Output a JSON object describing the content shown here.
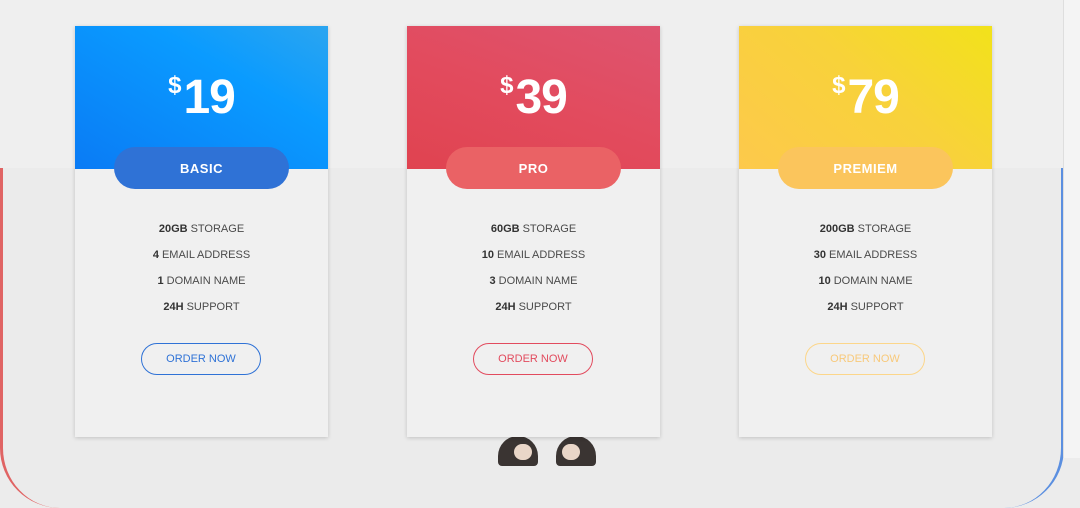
{
  "plans": [
    {
      "currency": "$",
      "price": "19",
      "name": "BASIC",
      "features": [
        {
          "value": "20GB",
          "label": "STORAGE"
        },
        {
          "value": "4",
          "label": "EMAIL ADDRESS"
        },
        {
          "value": "1",
          "label": "DOMAIN NAME"
        },
        {
          "value": "24H",
          "label": "SUPPORT"
        }
      ],
      "cta": "ORDER NOW"
    },
    {
      "currency": "$",
      "price": "39",
      "name": "PRO",
      "features": [
        {
          "value": "60GB",
          "label": "STORAGE"
        },
        {
          "value": "10",
          "label": "EMAIL ADDRESS"
        },
        {
          "value": "3",
          "label": "DOMAIN NAME"
        },
        {
          "value": "24H",
          "label": "SUPPORT"
        }
      ],
      "cta": "ORDER NOW"
    },
    {
      "currency": "$",
      "price": "79",
      "name": "PREMIEM",
      "features": [
        {
          "value": "200GB",
          "label": "STORAGE"
        },
        {
          "value": "30",
          "label": "EMAIL ADDRESS"
        },
        {
          "value": "10",
          "label": "DOMAIN NAME"
        },
        {
          "value": "24H",
          "label": "SUPPORT"
        }
      ],
      "cta": "ORDER NOW"
    }
  ],
  "colors": {
    "basic": "#2f72d6",
    "pro": "#e24b5e",
    "premium": "#fbc55c"
  }
}
